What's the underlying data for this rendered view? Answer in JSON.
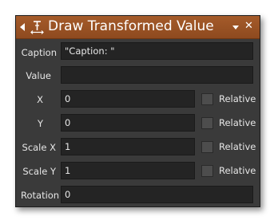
{
  "window": {
    "title": "Draw Transformed Value",
    "icons": [
      "collapse-arrow-icon",
      "text-cursor-icon",
      "chevron-down-icon",
      "close-icon"
    ],
    "close_glyph": "✕"
  },
  "fields": {
    "caption": {
      "label": "Caption",
      "value": "\"Caption: \""
    },
    "value": {
      "label": "Value",
      "value": ""
    },
    "x": {
      "label": "X",
      "value": "0",
      "relative_label": "Relative",
      "relative_checked": false
    },
    "y": {
      "label": "Y",
      "value": "0",
      "relative_label": "Relative",
      "relative_checked": false
    },
    "scale_x": {
      "label": "Scale X",
      "value": "1",
      "relative_label": "Relative",
      "relative_checked": false
    },
    "scale_y": {
      "label": "Scale Y",
      "value": "1",
      "relative_label": "Relative",
      "relative_checked": false
    },
    "rotation": {
      "label": "Rotation",
      "value": "0"
    }
  },
  "colors": {
    "titlebar": "#9a5224",
    "panel": "#3a3a3a",
    "field": "#242424",
    "text": "#e6e6e6"
  }
}
